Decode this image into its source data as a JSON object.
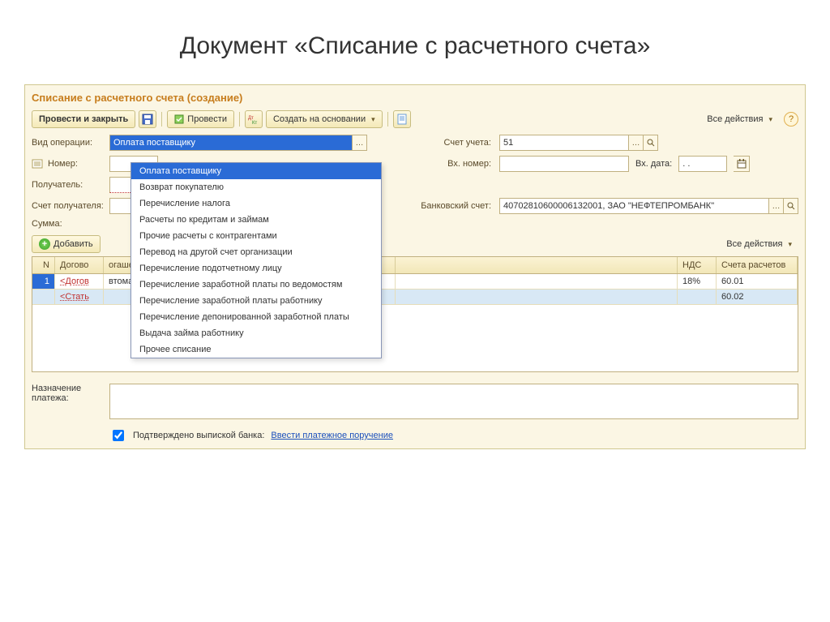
{
  "slide_title": "Документ «Списание с расчетного счета»",
  "form_title": "Списание с расчетного счета (создание)",
  "toolbar": {
    "submit_close": "Провести и закрыть",
    "submit": "Провести",
    "create_based": "Создать на основании",
    "all_actions": "Все действия"
  },
  "labels": {
    "op_type": "Вид операции:",
    "number": "Номер:",
    "recipient": "Получатель:",
    "recipient_acc": "Счет получателя:",
    "amount": "Сумма:",
    "acc_code": "Счет учета:",
    "in_number": "Вх. номер:",
    "in_date": "Вх. дата:",
    "bank_acc": "Банковский счет:",
    "purpose": "Назначение платежа:",
    "confirmed": "Подтверждено выпиской банка:",
    "enter_po": "Ввести платежное поручение"
  },
  "values": {
    "op_type": "Оплата поставщику",
    "acc_code": "51",
    "bank_acc": "40702810600006132001, ЗАО \"НЕФТЕПРОМБАНК\"",
    "in_date": ". ."
  },
  "dropdown_items": [
    "Оплата поставщику",
    "Возврат покупателю",
    "Перечисление налога",
    "Расчеты по кредитам и займам",
    "Прочие расчеты с контрагентами",
    "Перевод на другой счет организации",
    "Перечисление подотчетному лицу",
    "Перечисление заработной платы по ведомостям",
    "Перечисление заработной платы работнику",
    "Перечисление депонированной заработной платы",
    "Выдача займа работнику",
    "Прочее списание"
  ],
  "add_btn": "Добавить",
  "grid": {
    "headers": {
      "n": "N",
      "dog": "Догово",
      "debt": "огашение задолженности",
      "nds": "НДС",
      "acc": "Счета расчетов"
    },
    "rows": [
      {
        "n": "1",
        "dog": "<Догов",
        "debt": "втоматически",
        "nds": "18%",
        "acc": "60.01"
      },
      {
        "n": "",
        "dog": "<Стать",
        "debt": "",
        "nds": "",
        "acc": "60.02"
      }
    ]
  }
}
